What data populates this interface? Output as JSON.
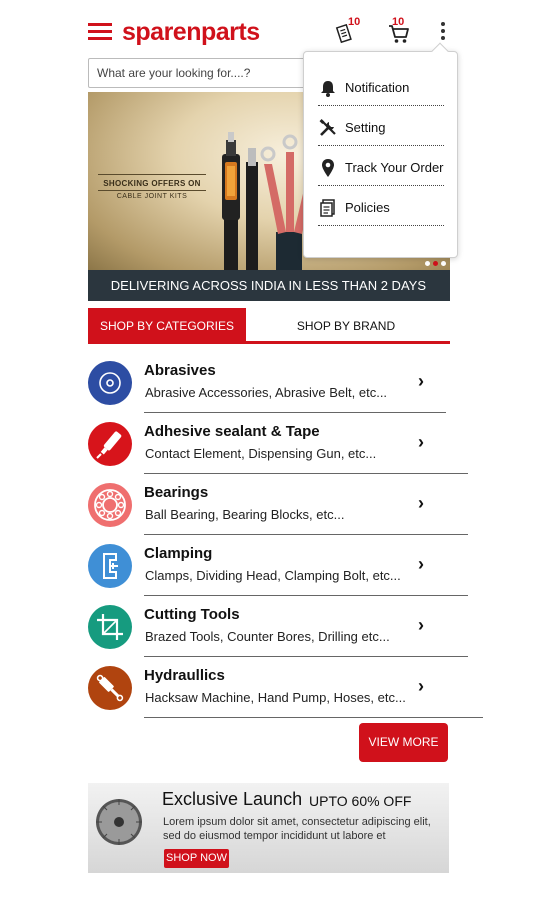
{
  "header": {
    "logo_text": "sparenparts",
    "orders_badge": "10",
    "cart_badge": "10"
  },
  "search": {
    "placeholder": "What are your looking for....?"
  },
  "banner": {
    "headline": "SHOCKING OFFERS ON",
    "subline": "CABLE JOINT KITS",
    "active_slide": 2,
    "slide_count": 3
  },
  "delivery_strip": "DELIVERING ACROSS INDIA IN LESS THAN 2 DAYS",
  "tabs": {
    "categories": "SHOP BY CATEGORIES",
    "brand": "SHOP BY BRAND"
  },
  "categories": [
    {
      "title": "Abrasives",
      "subtitle": "Abrasive Accessories, Abrasive Belt, etc...",
      "color": "#2d4da3",
      "icon": "disc-icon"
    },
    {
      "title": "Adhesive sealant & Tape",
      "subtitle": "Contact Element, Dispensing Gun, etc...",
      "color": "#d7141b",
      "icon": "glue-gun-icon"
    },
    {
      "title": "Bearings",
      "subtitle": "Ball Bearing, Bearing Blocks, etc...",
      "color": "#ef6f6f",
      "icon": "bearing-icon"
    },
    {
      "title": "Clamping",
      "subtitle": "Clamps, Dividing Head, Clamping Bolt, etc...",
      "color": "#3f8fd6",
      "icon": "clamp-icon"
    },
    {
      "title": "Cutting Tools",
      "subtitle": "Brazed Tools, Counter Bores, Drilling etc...",
      "color": "#169b7f",
      "icon": "crop-icon"
    },
    {
      "title": "Hydraullics",
      "subtitle": "Hacksaw Machine, Hand Pump, Hoses, etc...",
      "color": "#b0440f",
      "icon": "hydraulic-cylinder-icon"
    }
  ],
  "arrow_glyph": "›",
  "view_more": "VIEW MORE",
  "promo": {
    "title": "Exclusive Launch",
    "offer": "UPTO 60% OFF",
    "body": "Lorem ipsum dolor sit amet, consectetur adipiscing elit, sed do eiusmod tempor incididunt ut labore et",
    "button": "SHOP NOW"
  },
  "menu": {
    "items": [
      {
        "label": "Notification",
        "icon": "bell-icon"
      },
      {
        "label": "Setting",
        "icon": "tools-icon"
      },
      {
        "label": "Track Your Order",
        "icon": "location-pin-icon"
      },
      {
        "label": "Policies",
        "icon": "document-icon"
      }
    ]
  },
  "colors": {
    "brand_red": "#d0111b",
    "strip_dark": "#2b363e"
  }
}
